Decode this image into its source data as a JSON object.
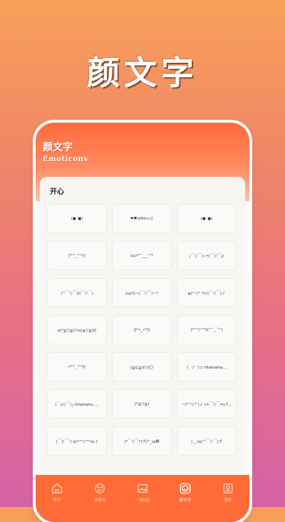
{
  "promo": {
    "title": "颜文字"
  },
  "header": {
    "title": "颜文字",
    "subtitle": "Emoticons"
  },
  "section": {
    "title": "开心"
  },
  "emoticons": [
    "(●´●)",
    "❤♥(ò∀ó•)♫",
    "(●´●)",
    "(*^_^*)(",
    "(ω)*^___^*",
    "(￣▽￣)~*(￣▽￣)/",
    "(^￣▽￣)/(￣▽￣)",
    "(ω)ⓑ~(￣▽￣)~*",
    "φ(° ▽° *)♪(￣▽￣)ノ",
    "o(*≧▽≦)ツo(≧▽≦)O",
    "(|*•_•*|)",
    "(*^▽^*)(^ˇ_ˇ^)",
    "(*^_^*)(",
    "(≧⊆≦)(▽)〇",
    "(ˊ ▽ ˋ)っ Hiahiahia...",
    "(￣y▽￣)╭ Ohohoho.....",
    "(*≧▽≦)",
    "ヽ(*^▽^)ノ (=￣▽￣=)人...",
    "(￣▽￣ˇ) o(*^▽^*)o ♪",
    "(*￣▽￣*)ブ(*_)a棋",
    "(._.)o(^￣▽￣)ブ"
  ],
  "tabbar": {
    "items": [
      {
        "label": "首页",
        "icon": "home-icon"
      },
      {
        "label": "表情包",
        "icon": "smile-icon"
      },
      {
        "label": "一键p图",
        "icon": "image-edit-icon"
      },
      {
        "label": "颜文字",
        "icon": "emoticon-icon"
      },
      {
        "label": "我的",
        "icon": "profile-icon"
      }
    ],
    "active_index": 3
  },
  "colors": {
    "accent": "#ff6b37",
    "header_top": "#ff6a3a",
    "card_bg": "#f8f6f2"
  }
}
